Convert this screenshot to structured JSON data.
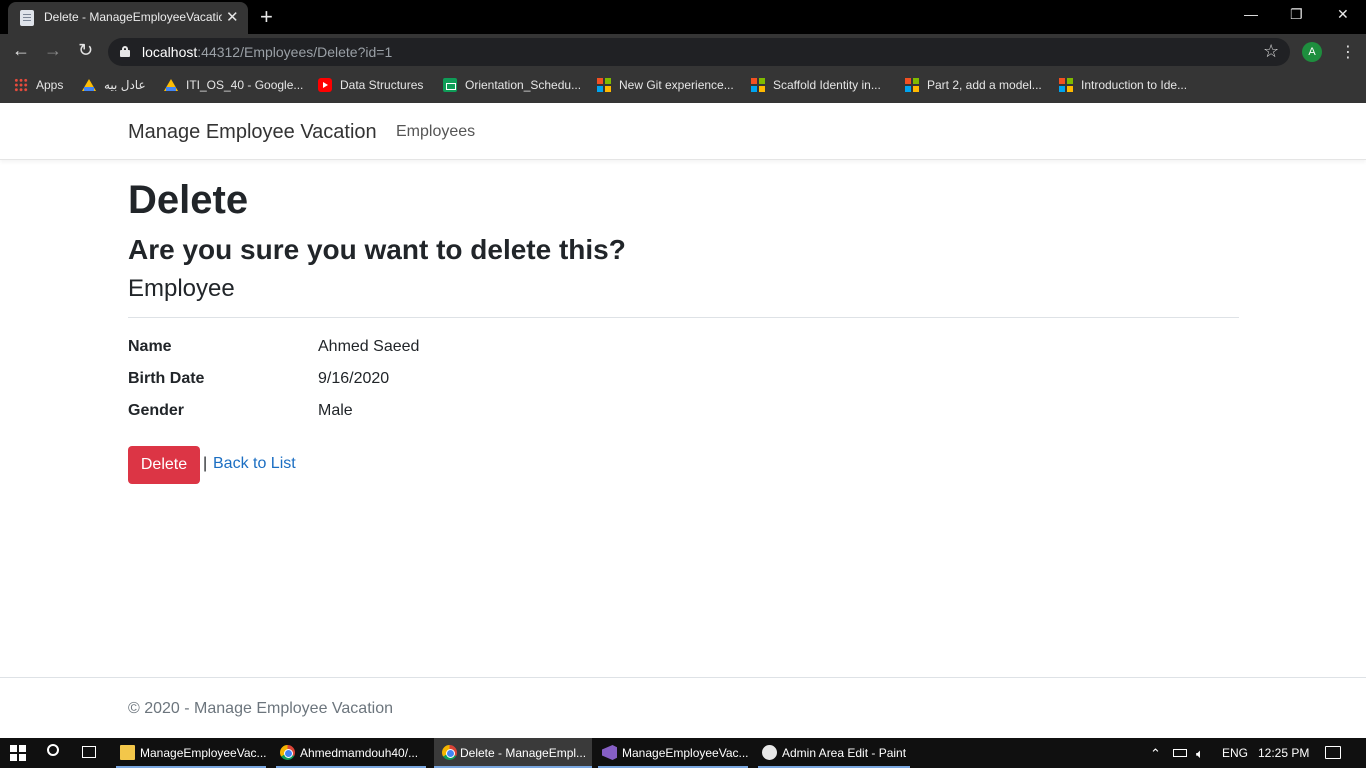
{
  "browser": {
    "tab_title": "Delete - ManageEmployeeVacation",
    "tab_close": "✕",
    "new_tab": "+",
    "win_min": "—",
    "win_restore": "❐",
    "win_close": "✕",
    "url_host": "localhost",
    "url_rest": ":44312/Employees/Delete?id=1",
    "profile_initial": "A",
    "bookmarks": [
      {
        "label": "Apps",
        "icon": "apps-grid-icon"
      },
      {
        "label": "عادل بيه",
        "icon": "google-drive-icon"
      },
      {
        "label": "ITI_OS_40 - Google...",
        "icon": "google-drive-icon"
      },
      {
        "label": "Data Structures",
        "icon": "youtube-icon"
      },
      {
        "label": "Orientation_Schedu...",
        "icon": "google-sheets-icon"
      },
      {
        "label": "New Git experience...",
        "icon": "microsoft-icon"
      },
      {
        "label": "Scaffold Identity in...",
        "icon": "microsoft-icon"
      },
      {
        "label": "Part 2, add a model...",
        "icon": "microsoft-icon"
      },
      {
        "label": "Introduction to Ide...",
        "icon": "microsoft-icon"
      }
    ]
  },
  "navbar": {
    "brand": "Manage Employee Vacation",
    "link_employees": "Employees"
  },
  "page": {
    "title": "Delete",
    "question": "Are you sure you want to delete this?",
    "entity": "Employee",
    "fields": [
      {
        "label": "Name",
        "value": "Ahmed Saeed"
      },
      {
        "label": "Birth Date",
        "value": "9/16/2020"
      },
      {
        "label": "Gender",
        "value": "Male"
      }
    ],
    "delete_label": "Delete",
    "separator": "|",
    "back_label": "Back to List",
    "footer": "© 2020 - Manage Employee Vacation"
  },
  "taskbar": {
    "items": [
      {
        "label": "ManageEmployeeVac...",
        "icon": "folder-icon"
      },
      {
        "label": "Ahmedmamdouh40/...",
        "icon": "chrome-icon"
      },
      {
        "label": "Delete - ManageEmpl...",
        "icon": "chrome-icon"
      },
      {
        "label": "ManageEmployeeVac...",
        "icon": "visual-studio-icon"
      },
      {
        "label": "Admin Area Edit - Paint",
        "icon": "paint-icon"
      }
    ],
    "lang": "ENG",
    "time": "12:25 PM"
  },
  "colors": {
    "danger": "#dc3545",
    "link": "#1b6ec2",
    "browser_chrome": "#353535"
  }
}
